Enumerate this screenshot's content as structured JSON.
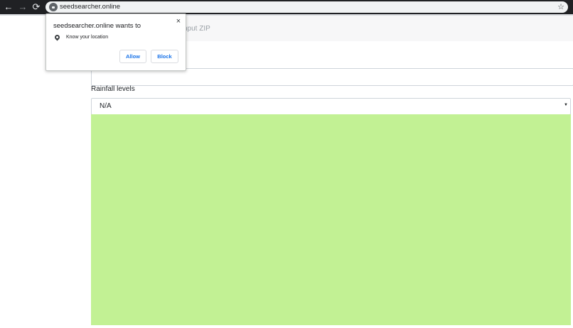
{
  "browser": {
    "back_glyph": "←",
    "forward_glyph": "→",
    "reload_glyph": "⟳",
    "url": "seedsearcher.online",
    "bookmark_glyph": "☆",
    "icons": [
      "back-arrow-icon",
      "forward-arrow-icon",
      "reload-icon",
      "lock-icon",
      "star-icon"
    ]
  },
  "page": {
    "header_text": "nput ZIP",
    "text_input_value": "",
    "rainfall_label": "Rainfall levels",
    "rainfall_selected": "N/A",
    "panel_color": "#c2f194"
  },
  "popup": {
    "title": "seedsearcher.online wants to",
    "close_glyph": "×",
    "permission": "Know your location",
    "allow_label": "Allow",
    "block_label": "Block",
    "icons": [
      "close-icon",
      "location-pin-icon"
    ]
  }
}
